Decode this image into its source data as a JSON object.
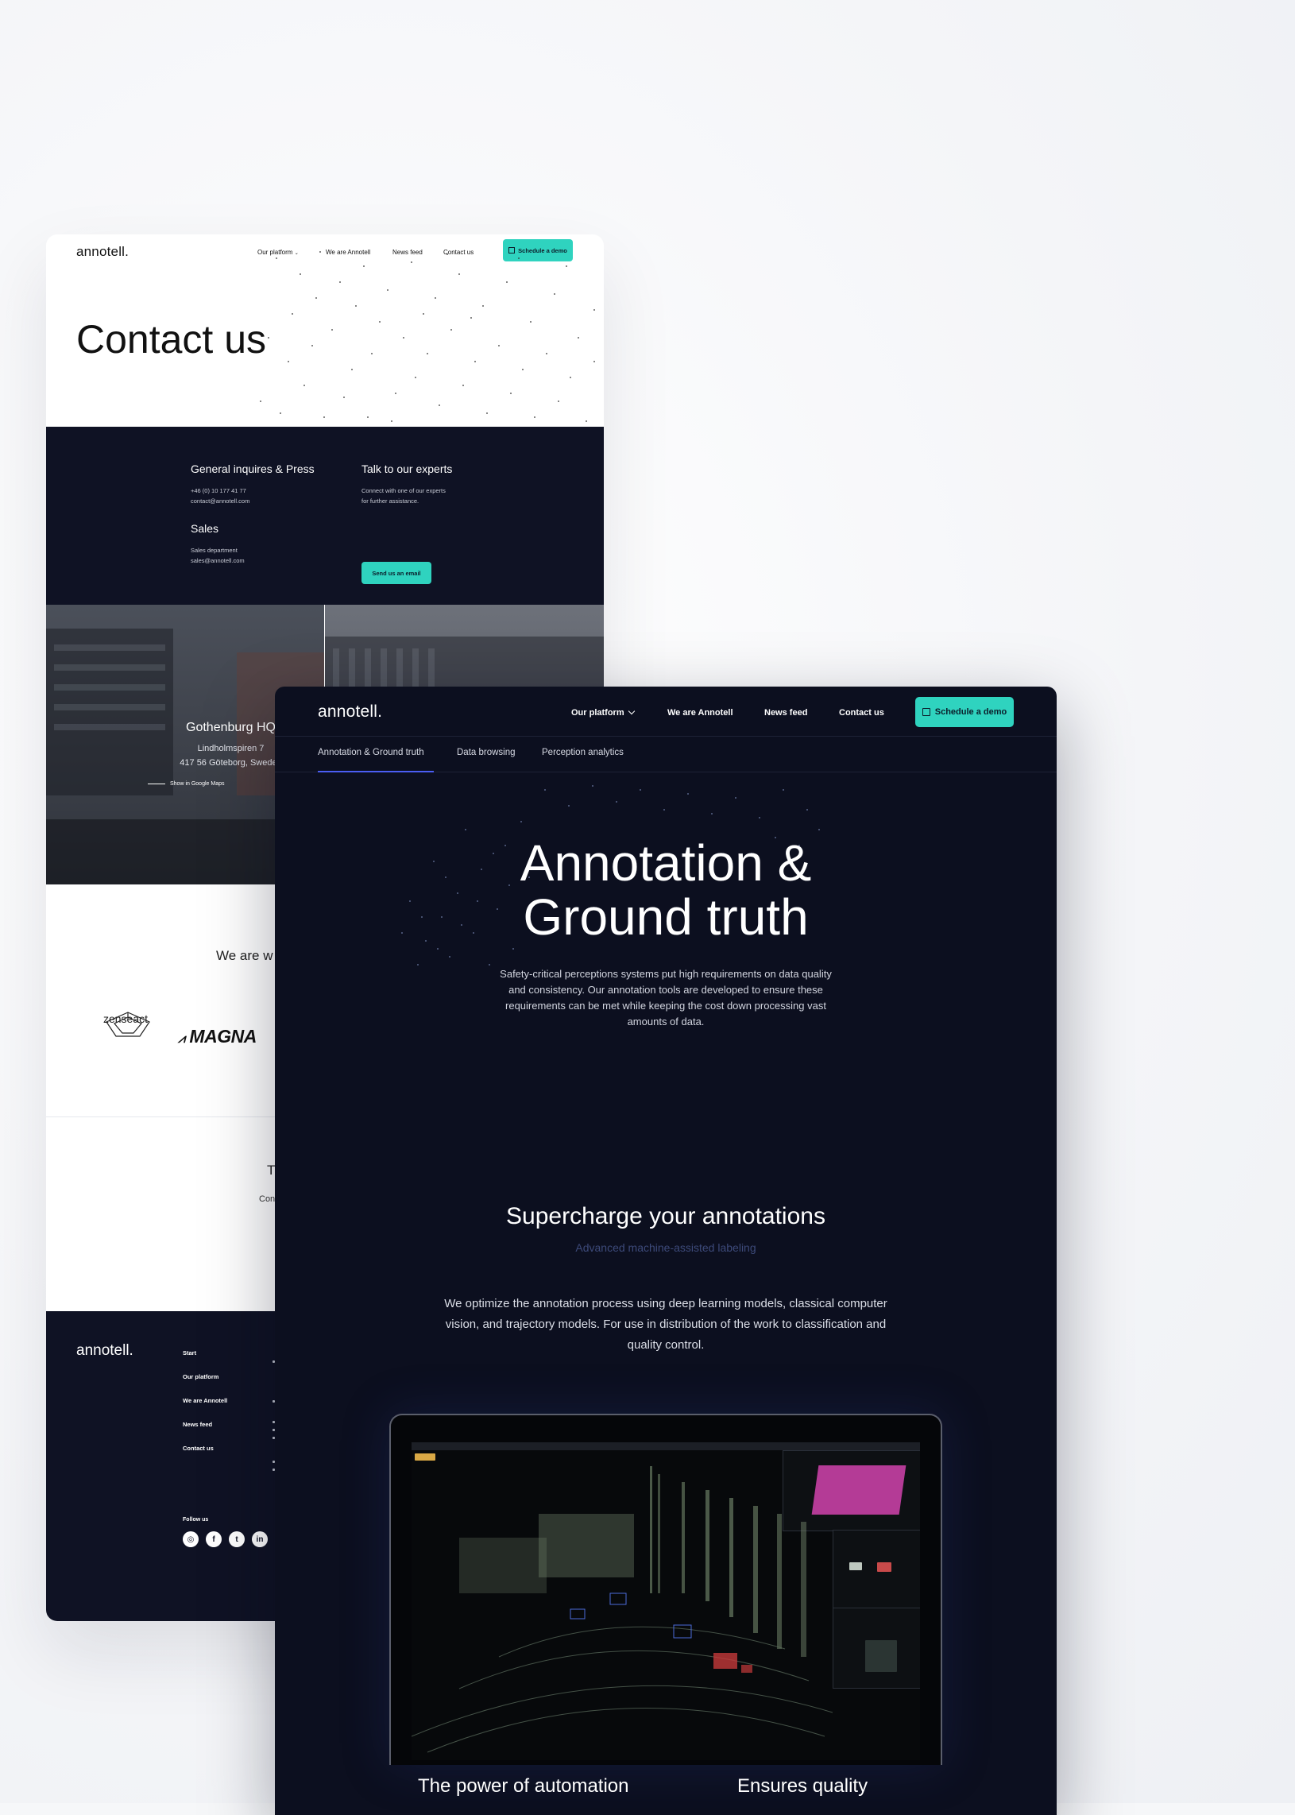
{
  "contact_page": {
    "logo": "annotell.",
    "nav": {
      "items": [
        "Our platform",
        "We are Annotell",
        "News feed",
        "Contact us"
      ],
      "cta": "Schedule a demo"
    },
    "title": "Contact us",
    "general": {
      "heading": "General inquires & Press",
      "phone": "+46 (0) 10 177 41 77",
      "email": "contact@annotell.com"
    },
    "sales": {
      "heading": "Sales",
      "department": "Sales department",
      "email": "sales@annotell.com"
    },
    "experts": {
      "heading": "Talk to our experts",
      "line1": "Connect with one of our experts",
      "line2": "for further assistance.",
      "button": "Send us an email"
    },
    "hq": {
      "title": "Gothenburg HQ",
      "street": "Lindholmspiren 7",
      "city": "417 56 Göteborg, Sweden",
      "maps_link": "Show in Google Maps"
    },
    "partners_heading_fragment": "We are w",
    "partners": [
      "zenseact",
      "MAGNA"
    ],
    "talk_fragment": "T",
    "con_fragment": "Con",
    "footer": {
      "logo": "annotell.",
      "links": [
        "Start",
        "Our platform",
        "We are Annotell",
        "News feed",
        "Contact us"
      ],
      "follow": "Follow us",
      "social": [
        "instagram-icon",
        "facebook-icon",
        "twitter-icon",
        "linkedin-icon"
      ]
    }
  },
  "annotation_page": {
    "logo": "annotell.",
    "nav": {
      "items": [
        "Our platform",
        "We are Annotell",
        "News feed",
        "Contact us"
      ],
      "cta": "Schedule a demo"
    },
    "tabs": [
      "Annotation & Ground truth",
      "Data browsing",
      "Perception analytics"
    ],
    "active_tab": 0,
    "hero": {
      "title_line1": "Annotation &",
      "title_line2": "Ground truth",
      "paragraph": "Safety-critical perceptions systems put high requirements on data quality and consistency. Our annotation tools are developed to ensure these requirements can be met while keeping the cost down processing vast amounts of data."
    },
    "section": {
      "heading": "Supercharge your annotations",
      "subheading": "Advanced machine-assisted labeling",
      "paragraph": "We optimize the annotation process using deep learning models, classical computer vision, and trajectory models. For use in distribution of the work to classification and quality control."
    },
    "bottom_headings": [
      "The power of automation",
      "Ensures quality"
    ],
    "colors": {
      "accent": "#2fd3bf",
      "dark_bg": "#0c0f1f",
      "tab_underline": "#4b5df2",
      "subheading": "#3d4a7a"
    }
  }
}
